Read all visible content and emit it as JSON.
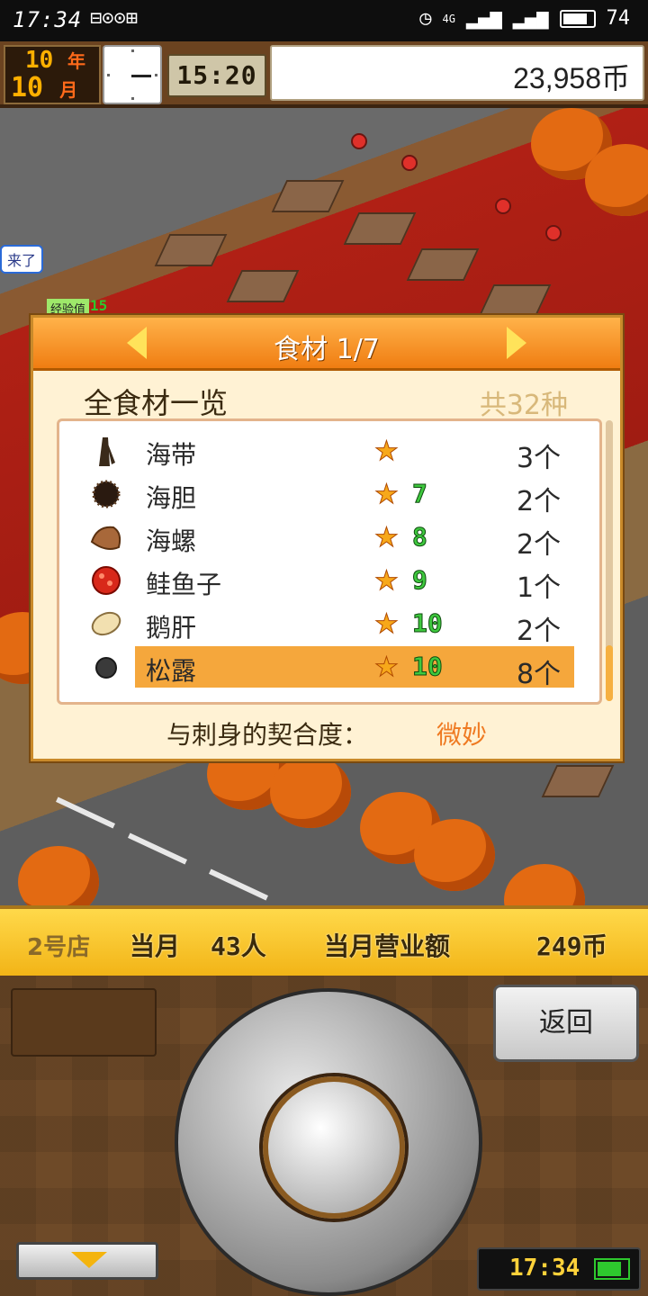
{
  "status_bar": {
    "time": "17:34",
    "left_icons": "⊟⊙⊙⊞",
    "network": "4G",
    "battery": "74"
  },
  "top_bar": {
    "year_number": "10",
    "year_unit": "年",
    "month_number": "10",
    "month_unit": "月",
    "time": "15:20",
    "money": "23,958币"
  },
  "scene": {
    "bubble_text": "来了",
    "exp_label": "经验值",
    "exp_value": "15"
  },
  "dialog": {
    "title": "食材 1/7",
    "subtitle": "全食材一览",
    "total": "共32种",
    "items": [
      {
        "name": "海带",
        "level": "",
        "qty": "3个",
        "icon": "kelp-icon",
        "color": "#3a2a1a"
      },
      {
        "name": "海胆",
        "level": "7",
        "qty": "2个",
        "icon": "sea-urchin-icon",
        "color": "#2a1a10"
      },
      {
        "name": "海螺",
        "level": "8",
        "qty": "2个",
        "icon": "conch-icon",
        "color": "#a8683a"
      },
      {
        "name": "鲑鱼子",
        "level": "9",
        "qty": "1个",
        "icon": "salmon-roe-icon",
        "color": "#d8281a"
      },
      {
        "name": "鹅肝",
        "level": "10",
        "qty": "2个",
        "icon": "foie-gras-icon",
        "color": "#f2e0b0"
      },
      {
        "name": "松露",
        "level": "10",
        "qty": "8个",
        "icon": "truffle-icon",
        "color": "#3a3a3a"
      }
    ],
    "compat_label": "与刺身的契合度：",
    "compat_value": "微妙"
  },
  "info_bar": {
    "store": "2号店",
    "month_label": "当月",
    "customers": "43人",
    "sales_label": "当月营业额",
    "sales": "249币"
  },
  "controller": {
    "back_label": "返回",
    "clock": "17:34"
  },
  "colors": {
    "accent_orange": "#f07d12",
    "selected_row": "#f5a73c",
    "star": "#f7a81a",
    "level_green": "#3ec83e"
  }
}
